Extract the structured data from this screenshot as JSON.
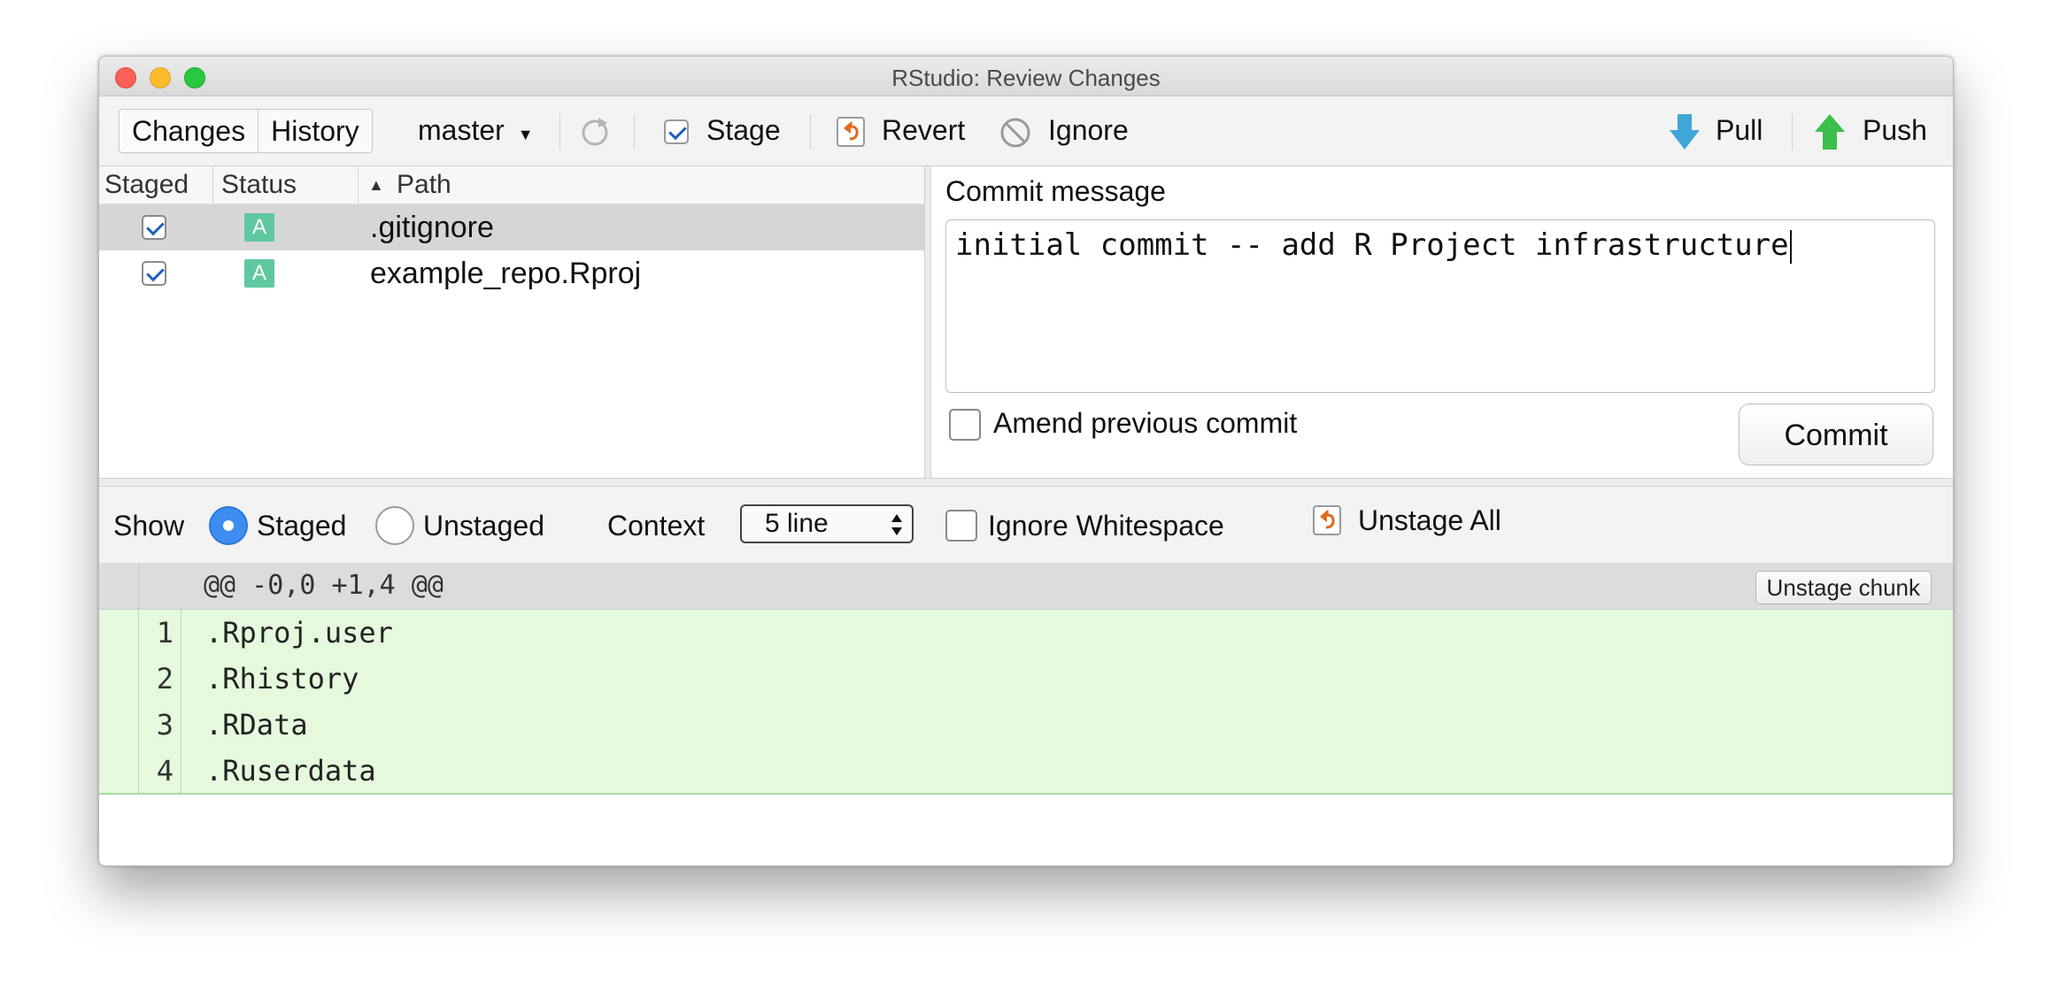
{
  "window": {
    "title": "RStudio: Review Changes"
  },
  "toolbar": {
    "tabs": [
      "Changes",
      "History"
    ],
    "branch": "master",
    "stage_label": "Stage",
    "revert_label": "Revert",
    "ignore_label": "Ignore",
    "pull_label": "Pull",
    "push_label": "Push"
  },
  "file_list": {
    "headers": {
      "staged": "Staged",
      "status": "Status",
      "path": "Path"
    },
    "rows": [
      {
        "staged": true,
        "status": "A",
        "path": ".gitignore",
        "selected": true
      },
      {
        "staged": true,
        "status": "A",
        "path": "example_repo.Rproj",
        "selected": false
      }
    ]
  },
  "commit": {
    "label": "Commit message",
    "message": "initial commit -- add R Project infrastructure",
    "amend_label": "Amend previous commit",
    "amend_checked": false,
    "button_label": "Commit"
  },
  "diff_toolbar": {
    "show_label": "Show",
    "staged_label": "Staged",
    "unstaged_label": "Unstaged",
    "selected_view": "Staged",
    "context_label": "Context",
    "context_value": "5 line",
    "ignore_whitespace_label": "Ignore Whitespace",
    "unstage_all_label": "Unstage All"
  },
  "diff": {
    "hunk_header": "@@ -0,0 +1,4 @@",
    "unstage_chunk_label": "Unstage chunk",
    "lines": [
      {
        "num": "1",
        "text": ".Rproj.user"
      },
      {
        "num": "2",
        "text": ".Rhistory"
      },
      {
        "num": "3",
        "text": ".RData"
      },
      {
        "num": "4",
        "text": ".Ruserdata"
      }
    ]
  },
  "colors": {
    "added_line_bg": "#e5f9dd",
    "status_added": "#5fc8a0",
    "radio_selected": "#3d8ef0"
  }
}
